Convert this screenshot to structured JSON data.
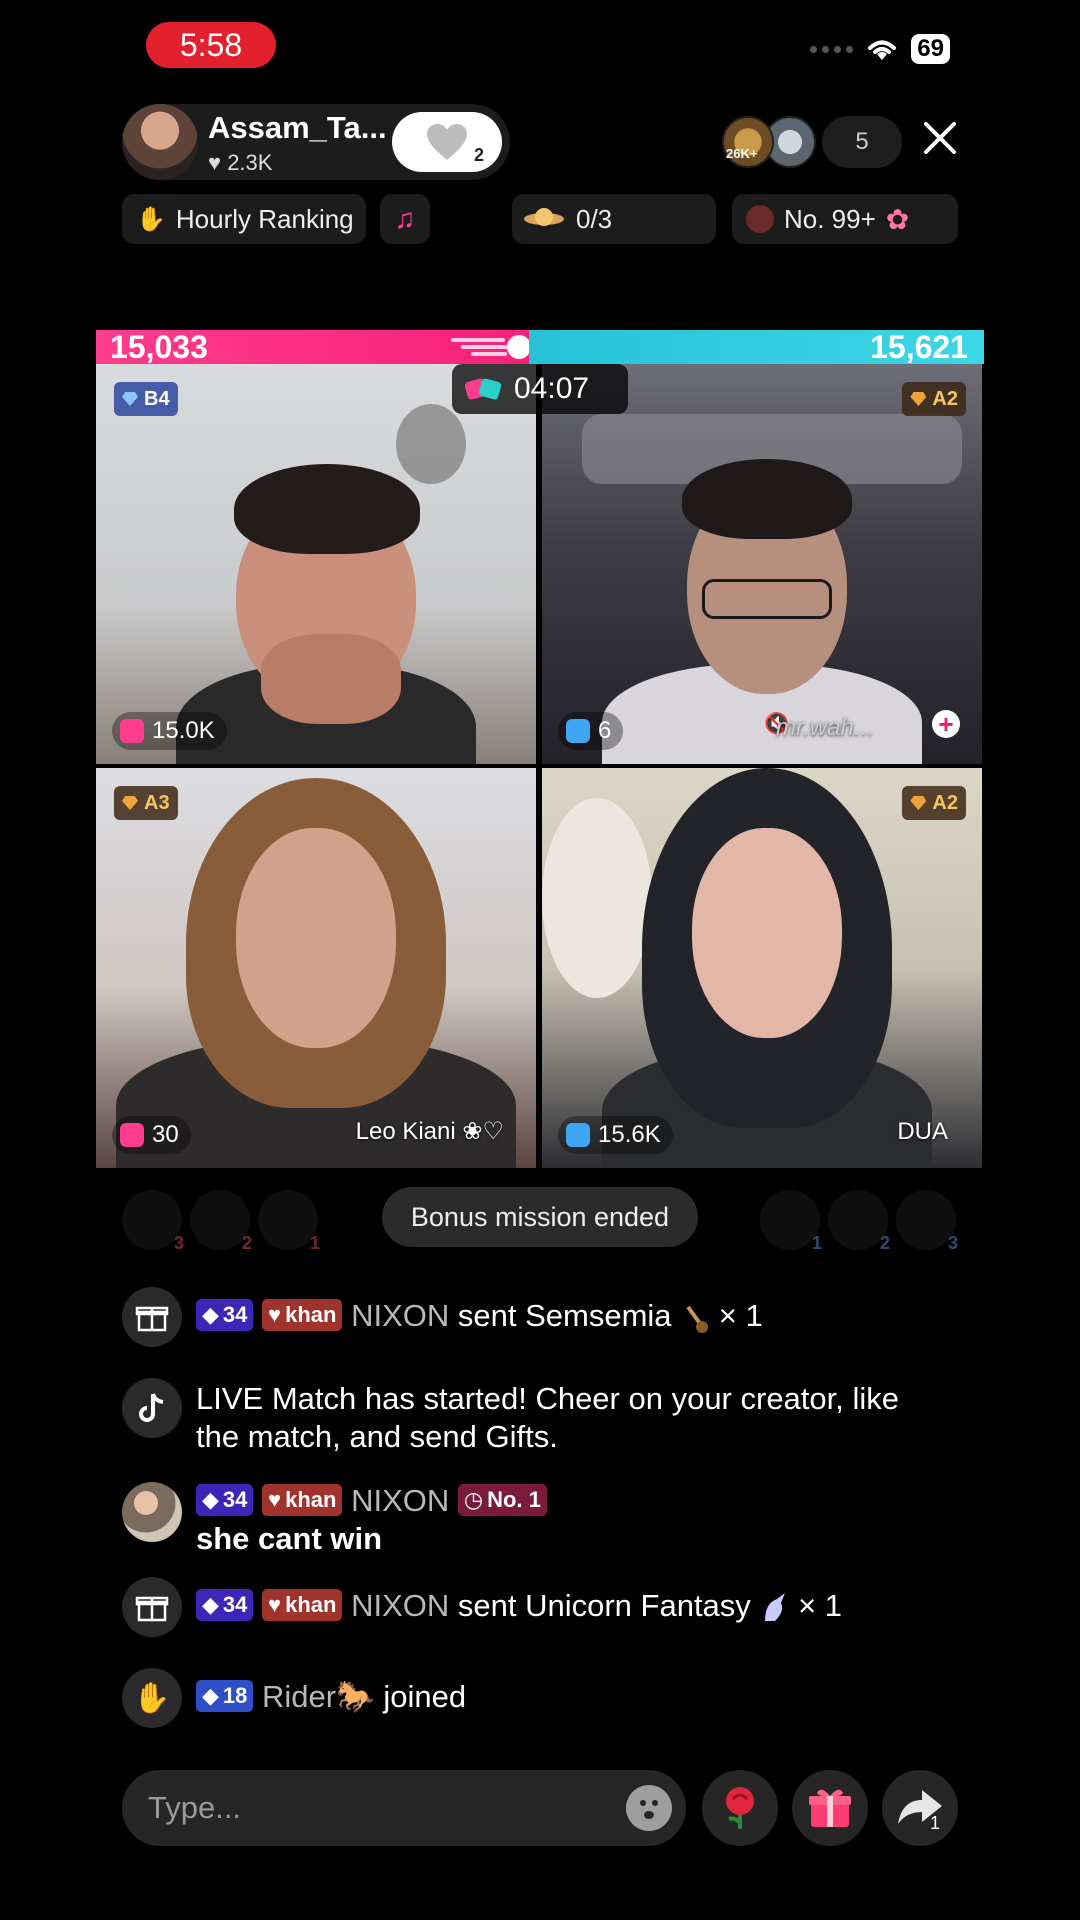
{
  "status": {
    "time": "5:58",
    "battery": "69"
  },
  "host": {
    "name": "Assam_Ta...",
    "likes": "2.3K",
    "follow_count": "2"
  },
  "viewers": {
    "count": "5",
    "top_badge": "26K+"
  },
  "chips": {
    "ranking": "Hourly Ranking",
    "mission": "0/3",
    "rank_number": "No. 99+"
  },
  "battle": {
    "left_score": "15,033",
    "right_score": "15,621",
    "timer": "04:07"
  },
  "tiles": [
    {
      "badge": "B4",
      "stat": "15.0K",
      "name": ""
    },
    {
      "badge": "A2",
      "stat": "6",
      "name": "mr.wah..."
    },
    {
      "badge": "A3",
      "stat": "30",
      "name": "Leo Kiani ❀♡"
    },
    {
      "badge": "A2",
      "stat": "15.6K",
      "name": "DUA"
    }
  ],
  "supporters": {
    "left_ranks": [
      "3",
      "2",
      "1"
    ],
    "right_ranks": [
      "1",
      "2",
      "3"
    ],
    "notice": "Bonus mission ended"
  },
  "chat": [
    {
      "type": "gift",
      "level": "34",
      "fan": "khan",
      "user": "NIXON",
      "text": "sent Semsemia",
      "multiplier": "× 1"
    },
    {
      "type": "system",
      "text": "LIVE Match has started! Cheer on your creator, like the match, and send Gifts."
    },
    {
      "type": "comment",
      "level": "34",
      "fan": "khan",
      "user": "NIXON",
      "rank": "No. 1",
      "text": "she cant win"
    },
    {
      "type": "gift",
      "level": "34",
      "fan": "khan",
      "user": "NIXON",
      "text": "sent Unicorn Fantasy",
      "multiplier": "× 1"
    },
    {
      "type": "join",
      "level": "18",
      "user": "Rider🐎",
      "text": "joined"
    }
  ],
  "input": {
    "placeholder": "Type..."
  },
  "share": {
    "count": "1"
  },
  "colors": {
    "left_team": "#f8217a",
    "right_team": "#3dd6e6",
    "status_time_bg": "#e3202e"
  }
}
